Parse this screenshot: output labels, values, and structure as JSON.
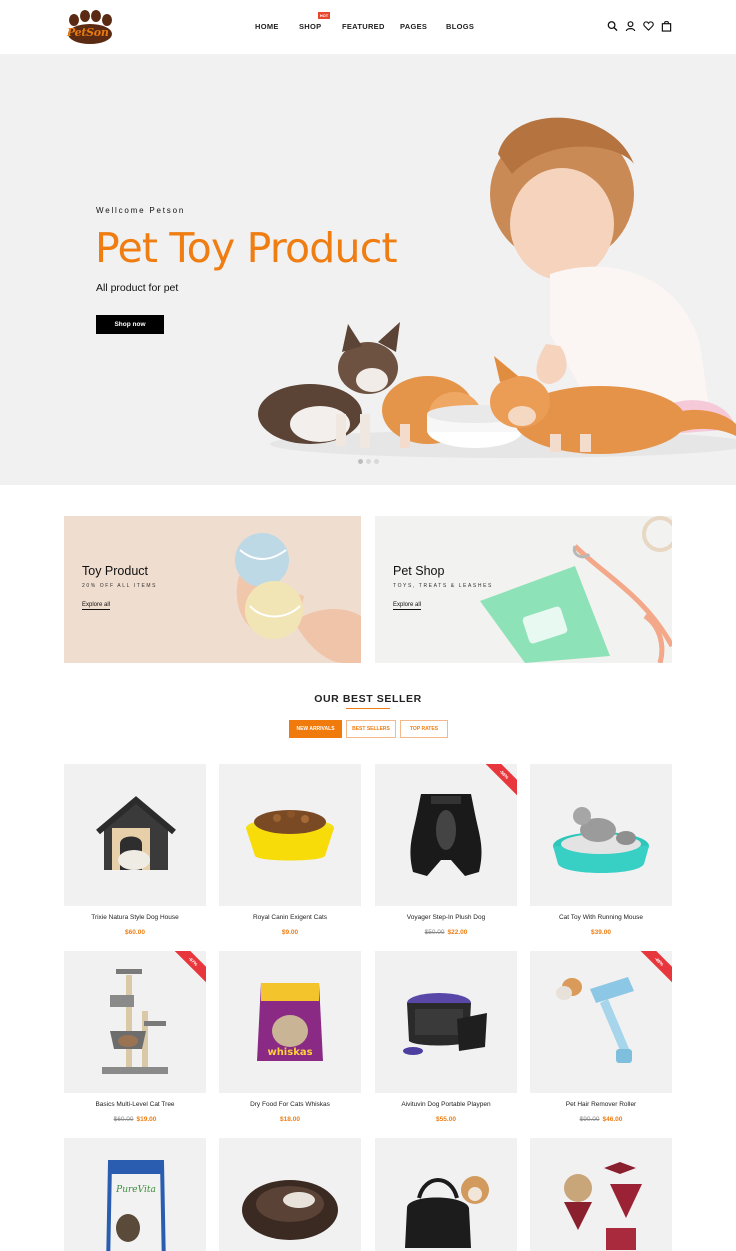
{
  "brand": {
    "logo_text": "PetSon"
  },
  "nav": {
    "home": "HOME",
    "shop": "SHOP",
    "shop_badge": "HOT",
    "featured": "FEATURED",
    "pages": "PAGES",
    "blogs": "BLOGS"
  },
  "hero": {
    "subtitle": "Wellcome Petson",
    "title": "Pet Toy Product",
    "description": "All product for pet",
    "button": "Shop now",
    "slides": 3,
    "active_slide": 1
  },
  "banners": [
    {
      "title": "Toy Product",
      "subtitle": "20% OFF ALL ITEMS",
      "link": "Explore all"
    },
    {
      "title": "Pet Shop",
      "subtitle": "TOYS, TREATS & LEASHES",
      "link": "Explore all"
    }
  ],
  "best_seller": {
    "title": "OUR BEST SELLER",
    "tabs": [
      "NEW ARRIVALS",
      "BEST SELLERS",
      "TOP RATES"
    ],
    "active_tab": 0
  },
  "products": [
    {
      "name": "Trixie Natura Style Dog House",
      "price": "$60.00",
      "old_price": "",
      "badge": ""
    },
    {
      "name": "Royal Canin Exigent Cats",
      "price": "$9.00",
      "old_price": "",
      "badge": ""
    },
    {
      "name": "Voyager Step-In Plush Dog",
      "price": "$22.00",
      "old_price": "$50.00",
      "badge": "-56%"
    },
    {
      "name": "Cat Toy With Running Mouse",
      "price": "$39.00",
      "old_price": "",
      "badge": ""
    },
    {
      "name": "Basics Multi-Level Cat Tree",
      "price": "$19.00",
      "old_price": "$60.00",
      "badge": "-67%"
    },
    {
      "name": "Dry Food For Cats Whiskas",
      "price": "$18.00",
      "old_price": "",
      "badge": ""
    },
    {
      "name": "Aivituvin Dog Portable Playpen",
      "price": "$55.00",
      "old_price": "",
      "badge": ""
    },
    {
      "name": "Pet Hair Remover Roller",
      "price": "$46.00",
      "old_price": "$90.00",
      "badge": "-49%"
    }
  ],
  "product_image_labels": {
    "whiskas": "whiskas",
    "purevita": "PureVita"
  },
  "colors": {
    "accent": "#ef7d12",
    "sale": "#e8363d",
    "dark": "#000000"
  },
  "icons": [
    "search-icon",
    "user-icon",
    "heart-icon",
    "bag-icon"
  ]
}
